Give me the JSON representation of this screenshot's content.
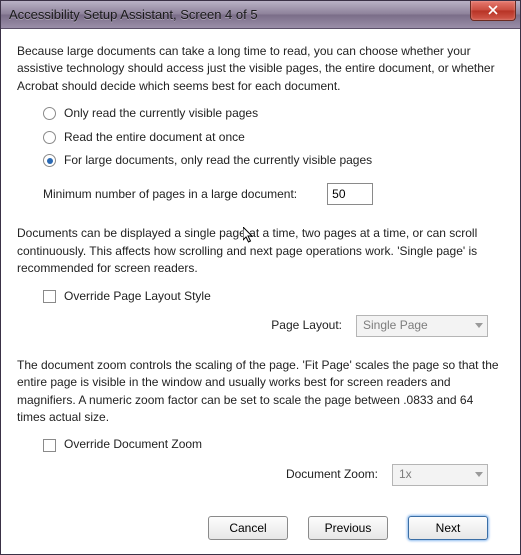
{
  "titlebar": {
    "title": "Accessibility Setup Assistant, Screen 4 of 5"
  },
  "section1": {
    "intro": "Because large documents can take a long time to read, you can choose whether your assistive technology should access just the visible pages, the entire document, or whether Acrobat should decide which seems best for each document.",
    "options": {
      "visible": "Only read the currently visible pages",
      "entire": "Read the entire document at once",
      "large": "For large documents, only read the currently visible pages"
    },
    "selected": "large",
    "min_label": "Minimum number of pages in a large document:",
    "min_value": "50"
  },
  "section2": {
    "intro": "Documents can be displayed a single page at a time, two pages at a time, or can scroll continuously. This affects how scrolling and next page operations work. 'Single page' is recommended for screen readers.",
    "override_label": "Override Page Layout Style",
    "layout_label": "Page Layout:",
    "layout_value": "Single Page"
  },
  "section3": {
    "intro": "The document zoom controls the scaling of the page. 'Fit Page' scales the page so that the entire page is visible in the window and usually works best for screen readers and magnifiers. A numeric zoom factor can be set to scale the page between .0833 and 64 times actual size.",
    "override_label": "Override Document Zoom",
    "zoom_label": "Document Zoom:",
    "zoom_value": "1x"
  },
  "buttons": {
    "cancel": "Cancel",
    "previous": "Previous",
    "next": "Next"
  }
}
